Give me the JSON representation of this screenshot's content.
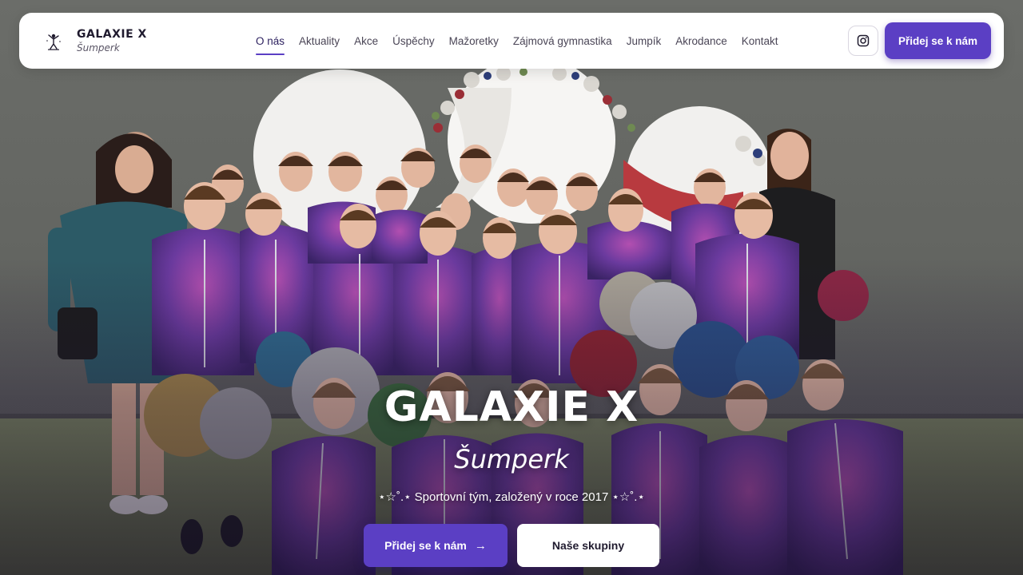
{
  "brand": {
    "name": "GALAXIE X",
    "city": "Šumperk"
  },
  "nav": {
    "items": [
      {
        "label": "O nás",
        "active": true
      },
      {
        "label": "Aktuality"
      },
      {
        "label": "Akce"
      },
      {
        "label": "Úspěchy"
      },
      {
        "label": "Mažoretky"
      },
      {
        "label": "Zájmová gymnastika"
      },
      {
        "label": "Jumpík"
      },
      {
        "label": "Akrodance"
      },
      {
        "label": "Kontakt"
      }
    ]
  },
  "header": {
    "instagram_icon": "instagram-icon",
    "join_label": "Přidej se k nám"
  },
  "hero": {
    "title": "GALAXIE X",
    "city": "Šumperk",
    "subtitle": "⋆☆˚.⋆ Sportovní tým, založený v roce 2017 ⋆☆˚.⋆",
    "cta_primary": "Přidej se k nám",
    "cta_primary_icon": "arrow-right-icon",
    "cta_secondary": "Naše skupiny"
  },
  "colors": {
    "accent": "#5b3fc4",
    "header_bg": "#ffffff",
    "text_dark": "#1f1a2e"
  }
}
